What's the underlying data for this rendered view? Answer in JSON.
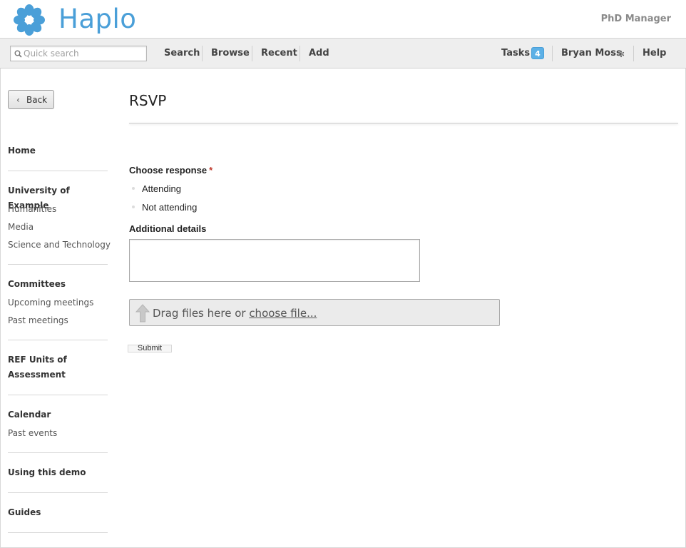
{
  "brand": {
    "name": "Haplo",
    "app_name": "PhD Manager",
    "accent": "#4a9fd8"
  },
  "navbar": {
    "search_placeholder": "Quick search",
    "items": [
      "Search",
      "Browse",
      "Recent",
      "Add"
    ],
    "tasks_label": "Tasks",
    "tasks_count": "4",
    "user_name": "Bryan Moss",
    "help_label": "Help"
  },
  "sidebar": {
    "back_label": "Back",
    "home": "Home",
    "university": {
      "heading": "University of Example",
      "links": [
        "Humanities",
        "Media",
        "Science and Technology"
      ]
    },
    "committees": {
      "heading": "Committees",
      "links": [
        "Upcoming meetings",
        "Past meetings"
      ]
    },
    "ref": {
      "heading": "REF Units of Assessment"
    },
    "calendar": {
      "heading": "Calendar",
      "links": [
        "Past events"
      ]
    },
    "demo": "Using this demo",
    "guides": "Guides"
  },
  "main": {
    "title": "RSVP",
    "response_label": "Choose response",
    "required_mark": "*",
    "options": [
      "Attending",
      "Not attending"
    ],
    "details_label": "Additional details",
    "details_value": "",
    "dropzone_text": "Drag files here or ",
    "dropzone_link": "choose file...",
    "submit_label": "Submit"
  }
}
